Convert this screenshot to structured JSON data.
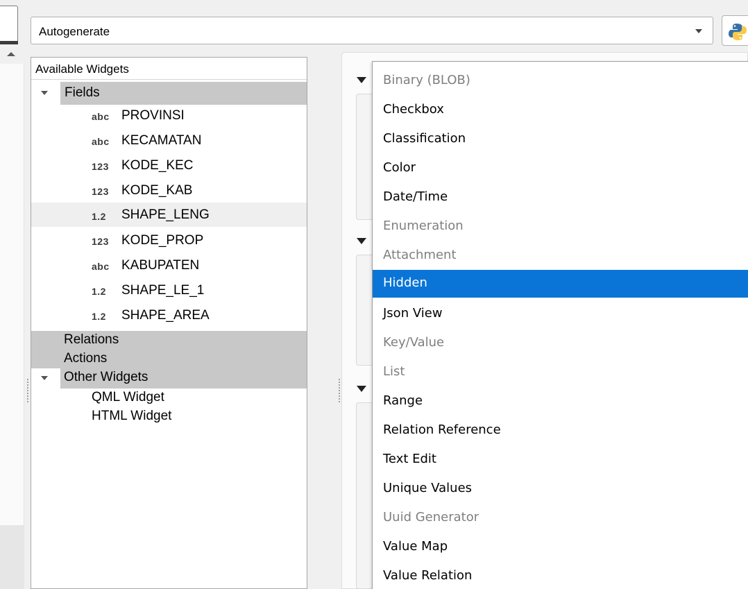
{
  "form": {
    "layout_value": "Autogenerate",
    "python_icon": "python-logo-icon"
  },
  "tree": {
    "header": "Available Widgets",
    "fields_label": "Fields",
    "fields": [
      {
        "type": "abc",
        "name": "PROVINSI"
      },
      {
        "type": "abc",
        "name": "KECAMATAN"
      },
      {
        "type": "123",
        "name": "KODE_KEC"
      },
      {
        "type": "123",
        "name": "KODE_KAB"
      },
      {
        "type": "1.2",
        "name": "SHAPE_LENG"
      },
      {
        "type": "123",
        "name": "KODE_PROP"
      },
      {
        "type": "abc",
        "name": "KABUPATEN"
      },
      {
        "type": "1.2",
        "name": "SHAPE_LE_1"
      },
      {
        "type": "1.2",
        "name": "SHAPE_AREA"
      }
    ],
    "relations_label": "Relations",
    "actions_label": "Actions",
    "other_label": "Other Widgets",
    "other_items": [
      "QML Widget",
      "HTML Widget"
    ]
  },
  "menu": {
    "items": [
      {
        "label": "Binary (BLOB)",
        "disabled": true
      },
      {
        "label": "Checkbox",
        "disabled": false
      },
      {
        "label": "Classification",
        "disabled": false
      },
      {
        "label": "Color",
        "disabled": false
      },
      {
        "label": "Date/Time",
        "disabled": false
      },
      {
        "label": "Enumeration",
        "disabled": true
      },
      {
        "label": "Attachment",
        "disabled": true
      },
      {
        "label": "Hidden",
        "disabled": false,
        "highlighted": true
      },
      {
        "label": "Json View",
        "disabled": false
      },
      {
        "label": "Key/Value",
        "disabled": true
      },
      {
        "label": "List",
        "disabled": true
      },
      {
        "label": "Range",
        "disabled": false
      },
      {
        "label": "Relation Reference",
        "disabled": false
      },
      {
        "label": "Text Edit",
        "disabled": false
      },
      {
        "label": "Unique Values",
        "disabled": false
      },
      {
        "label": "Uuid Generator",
        "disabled": true
      },
      {
        "label": "Value Map",
        "disabled": false
      },
      {
        "label": "Value Relation",
        "disabled": false
      }
    ]
  },
  "colors": {
    "highlight": "#0a75d6",
    "group_bg": "#c8c8c8",
    "disabled_text": "#7f7f7f"
  }
}
